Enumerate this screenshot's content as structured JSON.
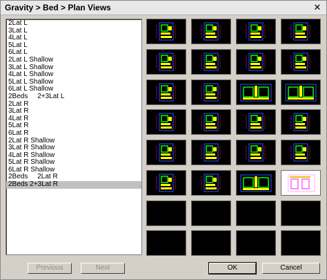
{
  "window": {
    "title": "Gravity > Bed > Plan Views",
    "close_glyph": "✕"
  },
  "list": {
    "items": [
      "2Lat L",
      "3Lat L",
      "4Lat L",
      "5Lat L",
      "6Lat L",
      "2Lat L Shallow",
      "3Lat L Shallow",
      "4Lat L Shallow",
      "5Lat L Shallow",
      "6Lat L Shallow",
      "2Beds     2+3Lat L",
      "2Lat R",
      "3Lat R",
      "4Lat R",
      "5Lat R",
      "6Lat R",
      "2Lat R Shallow",
      "3Lat R Shallow",
      "4Lat R Shallow",
      "5Lat R Shallow",
      "6Lat R Shallow",
      "2Beds     2Lat R",
      "2Beds 2+3Lat R"
    ],
    "selected_index": 22
  },
  "thumbnails": {
    "rows": [
      [
        "plan",
        "plan",
        "plan",
        "plan"
      ],
      [
        "plan",
        "plan",
        "plan",
        "plan"
      ],
      [
        "plan",
        "plan",
        "double",
        "double"
      ],
      [
        "plan",
        "plan",
        "plan",
        "plan"
      ],
      [
        "plan",
        "plan",
        "plan",
        "plan"
      ],
      [
        "plan",
        "plan",
        "double",
        "white"
      ],
      [
        "empty",
        "empty",
        "empty",
        "empty"
      ],
      [
        "empty",
        "empty",
        "empty",
        "empty"
      ]
    ]
  },
  "buttons": {
    "previous": "Previous",
    "next": "Next",
    "ok": "OK",
    "cancel": "Cancel"
  },
  "colors": {
    "thumb_bg": "#000000",
    "plan_green": "#00ff00",
    "plan_yellow": "#ffff00",
    "plan_blue": "#3050ff",
    "plan_magenta": "#ff00ff",
    "plan_red": "#ff2020",
    "selection": "#c0c0c0"
  }
}
